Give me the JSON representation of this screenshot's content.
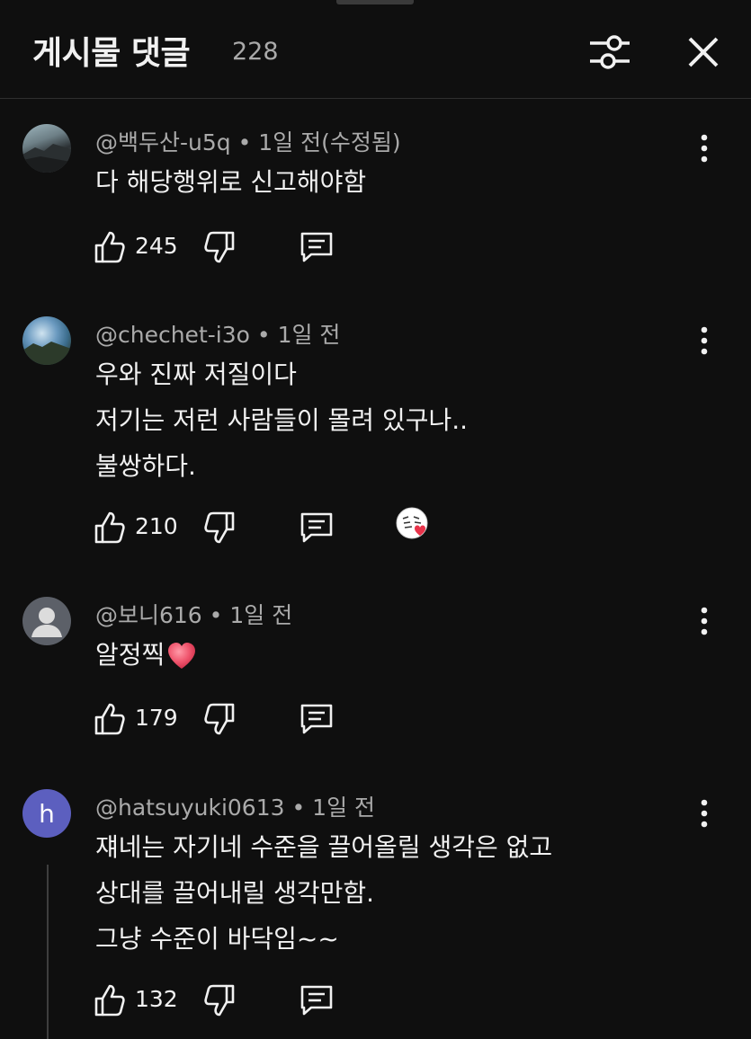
{
  "header": {
    "title": "게시물 댓글",
    "count": "228",
    "filter_icon": "sliders-icon",
    "close_icon": "close-icon"
  },
  "comments": [
    {
      "author": "@백두산-u5q",
      "time": "1일 전(수정됨)",
      "lines": [
        "다 해당행위로 신고해야함"
      ],
      "likes": "245",
      "creator_heart": false
    },
    {
      "author": "@chechet-i3o",
      "time": "1일 전",
      "lines": [
        "우와 진짜 저질이다",
        "저기는 저런 사람들이 몰려 있구나..",
        "불쌍하다."
      ],
      "likes": "210",
      "creator_heart": true
    },
    {
      "author": "@보니616",
      "time": "1일 전",
      "lines": [
        "알정찍"
      ],
      "emoji": "heart-emoji",
      "likes": "179",
      "creator_heart": false
    },
    {
      "author": "@hatsuyuki0613",
      "time": "1일 전",
      "avatar_letter": "h",
      "lines": [
        "쟤네는 자기네 수준을 끌어올릴 생각은 없고",
        "상대를 끌어내릴 생각만함.",
        "그냥 수준이 바닥임~~"
      ],
      "likes": "132",
      "creator_heart": false
    }
  ],
  "separator": " • ",
  "colors": {
    "background": "#0f0f0f",
    "text": "#f1f1f1",
    "muted": "#aaaaaa",
    "heart": "#e8334a"
  }
}
